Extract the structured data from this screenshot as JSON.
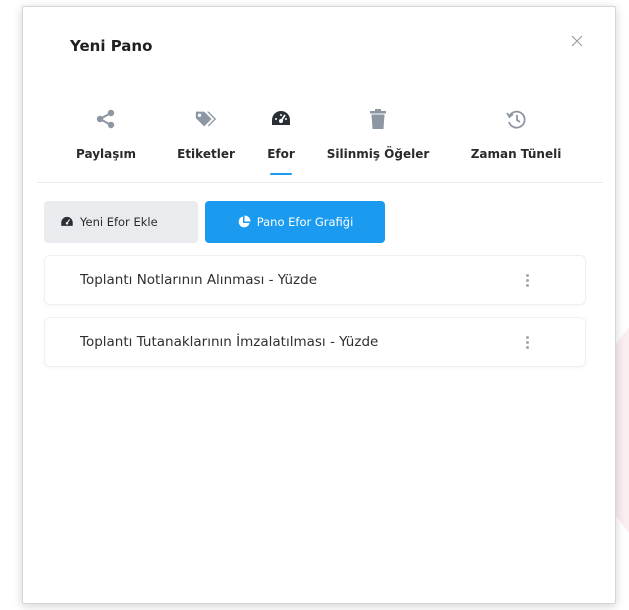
{
  "modal": {
    "title": "Yeni Pano",
    "close_icon": "close-icon"
  },
  "tabs": [
    {
      "label": "Paylaşım",
      "icon": "share-icon",
      "active": false
    },
    {
      "label": "Etiketler",
      "icon": "tags-icon",
      "active": false
    },
    {
      "label": "Efor",
      "icon": "dashboard-gauge-icon",
      "active": true
    },
    {
      "label": "Silinmiş Öğeler",
      "icon": "trash-icon",
      "active": false
    },
    {
      "label": "Zaman Tüneli",
      "icon": "history-icon",
      "active": false
    }
  ],
  "actions": {
    "new_effort_label": "Yeni Efor Ekle",
    "new_effort_icon": "dashboard-gauge-icon",
    "effort_chart_label": "Pano Efor Grafiği",
    "effort_chart_icon": "pie-chart-icon"
  },
  "effort_items": [
    {
      "text": "Toplantı Notlarının Alınması - Yüzde",
      "menu_icon": "kebab-menu-icon"
    },
    {
      "text": "Toplantı Tutanaklarının İmzalatılması - Yüzde",
      "menu_icon": "kebab-menu-icon"
    }
  ],
  "colors": {
    "accent": "#1a9bf0",
    "tab_icon": "#8d96a3",
    "active_tab_icon": "#2a2f36"
  }
}
